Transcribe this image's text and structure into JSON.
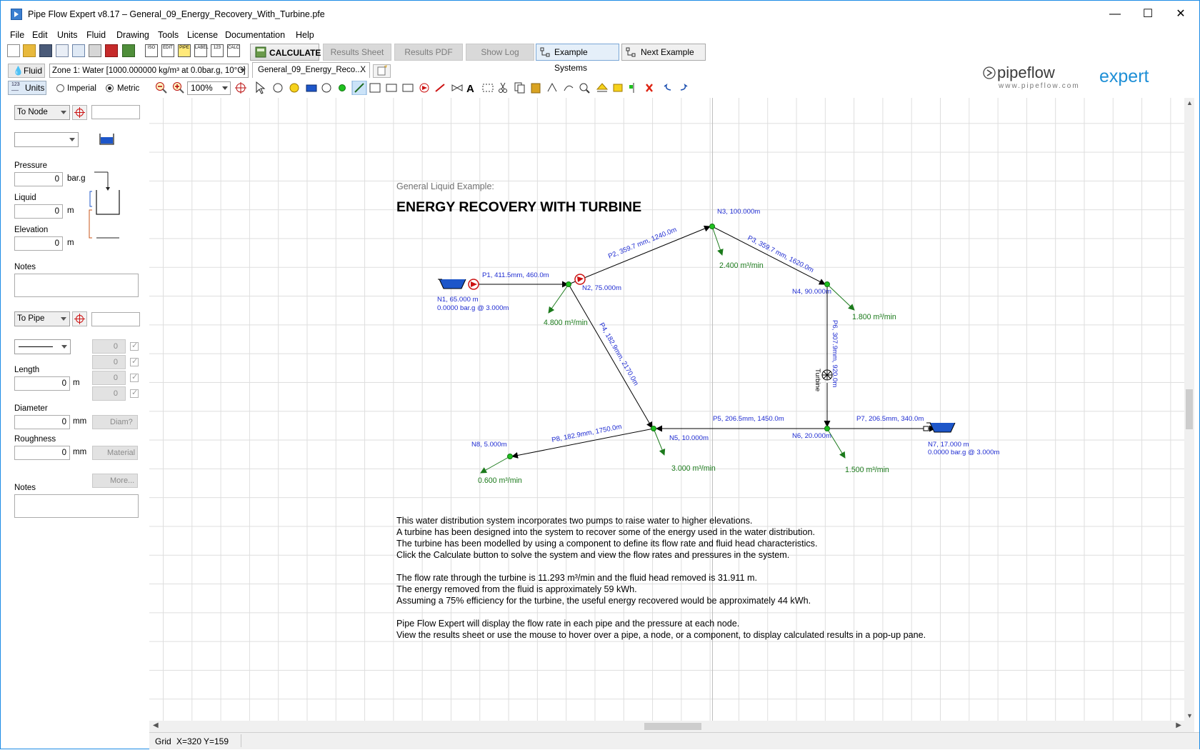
{
  "window": {
    "title": "Pipe Flow Expert v8.17 – General_09_Energy_Recovery_With_Turbine.pfe",
    "minimize": "—",
    "maximize": "☐",
    "close": "✕"
  },
  "menu": [
    "File",
    "Edit",
    "Units",
    "Fluid",
    "Drawing",
    "Tools",
    "License",
    "Documentation",
    "Help"
  ],
  "toolbar": {
    "icons": [
      "new-file-icon",
      "open-icon",
      "save-icon",
      "email-icon",
      "print-preview-icon",
      "print-icon",
      "pdf-icon",
      "spreadsheet-icon",
      "iso-icon",
      "edit-icon",
      "pipe-icon",
      "label-icon",
      "data-123-icon",
      "calc-icon"
    ],
    "small_labels": [
      "ISO",
      "EDIT",
      "PIPE",
      "LABEL",
      "123",
      "CALC"
    ],
    "calculate": "CALCULATE",
    "results_sheet": "Results Sheet",
    "results_pdf": "Results PDF",
    "show_log": "Show Log",
    "example_systems": "Example Systems",
    "next_example": "Next Example"
  },
  "fluid": {
    "button": "Fluid",
    "zone": "Zone 1: Water [1000.000000 kg/m³ at 0.0bar.g, 10°C]"
  },
  "document_tab": "General_09_Energy_Reco...",
  "document_tab_close": "X",
  "units": {
    "button": "Units",
    "imperial": "Imperial",
    "metric": "Metric",
    "selected": "Metric"
  },
  "zoom": "100%",
  "logo": {
    "main": "pipeflow",
    "sub": "expert",
    "url": "www.pipeflow.com"
  },
  "left_panel": {
    "node_select": "To Node",
    "node_name": "",
    "node_type": "",
    "pressure_label": "Pressure",
    "pressure_value": "0",
    "pressure_unit": "bar.g",
    "liquid_label": "Liquid",
    "liquid_value": "0",
    "liquid_unit": "m",
    "elevation_label": "Elevation",
    "elevation_value": "0",
    "elevation_unit": "m",
    "notes_label": "Notes",
    "pipe_select": "To Pipe",
    "pipe_name": "",
    "fitting_counts": [
      "0",
      "0",
      "0",
      "0"
    ],
    "length_label": "Length",
    "length_value": "0",
    "length_unit": "m",
    "diameter_label": "Diameter",
    "diameter_value": "0",
    "diameter_unit": "mm",
    "diam_button": "Diam?",
    "roughness_label": "Roughness",
    "roughness_value": "0",
    "roughness_unit": "mm",
    "material_button": "Material",
    "more_button": "More...",
    "notes2_label": "Notes"
  },
  "drawing": {
    "subtitle": "General Liquid Example:",
    "title": "ENERGY RECOVERY WITH TURBINE",
    "nodes": {
      "n1_a": "N1, 65.000 m",
      "n1_b": "0.0000 bar.g @ 3.000m",
      "n2": "N2, 75.000m",
      "n3": "N3, 100.000m",
      "n4": "N4, 90.000m",
      "n5": "N5, 10.000m",
      "n6": "N6, 20.000m",
      "n7_a": "N7, 17.000 m",
      "n7_b": "0.0000 bar.g @ 3.000m",
      "n8": "N8, 5.000m"
    },
    "pipes": {
      "p1": "P1, 411.5mm, 460.0m",
      "p2": "P2, 359.7 mm, 1240.0m",
      "p3": "P3, 359.7 mm, 1620.0m",
      "p4": "P4, 182.9mm, 2170.0m",
      "p5": "P5, 206.5mm, 1450.0m",
      "p6": "P6, 307.9mm, 920.0m",
      "p7": "P7, 206.5mm, 340.0m",
      "p8": "P8, 182.9mm, 1750.0m"
    },
    "demands": {
      "n2": "4.800 m³/min",
      "n3": "2.400 m³/min",
      "n4": "1.800 m³/min",
      "n5": "3.000 m³/min",
      "n6": "1.500 m³/min",
      "n8": "0.600 m³/min"
    },
    "turbine_label": "Turbine"
  },
  "description": [
    "This water distribution system incorporates two pumps to raise water to higher elevations.",
    "A turbine has been designed into the system to recover some of the energy used in the water distribution.",
    "The turbine has been modelled by using a component to define its flow rate and fluid head characteristics.",
    "Click the Calculate button to solve the system and view the flow rates and pressures in the system.",
    "",
    "The flow rate through the turbine is 11.293 m³/min and the fluid head removed is 31.911 m.",
    "The energy removed from the fluid is approximately 59 kWh.",
    "Assuming a 75% efficiency for the turbine, the useful energy recovered would be approximately 44 kWh.",
    "",
    "Pipe Flow Expert will display the flow rate in each pipe and the pressure at each node.",
    "View the results sheet or use the mouse to hover over a pipe, a node, or a component, to display calculated results in a pop-up pane."
  ],
  "status": {
    "grid": "Grid",
    "x": "X=320",
    "y": "Y=159"
  },
  "colors": {
    "pipe_label": "#1e2bd1",
    "demand": "#1b7a1b",
    "accent": "#1c8ce6"
  }
}
